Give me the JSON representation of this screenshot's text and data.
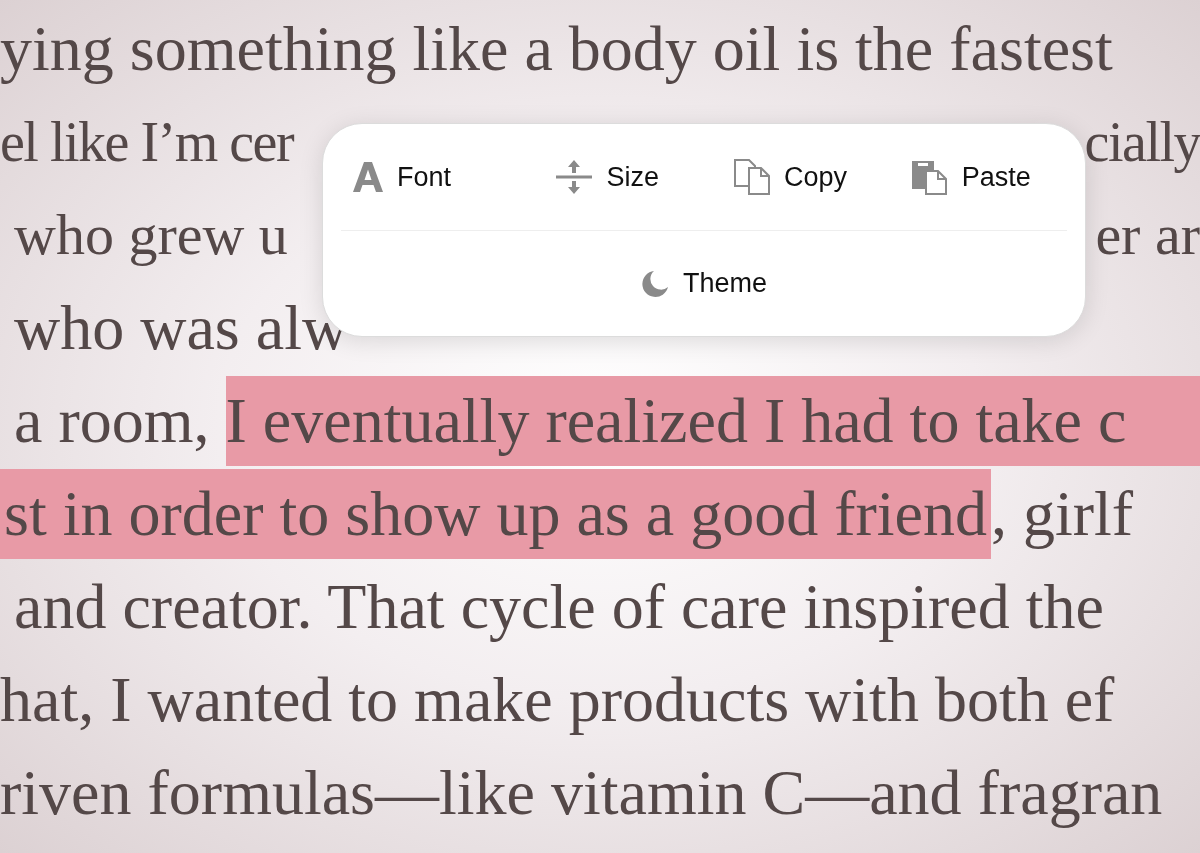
{
  "text_lines": [
    {
      "kind": "flow",
      "segments": [
        {
          "text": "ying something like a body oil is the fastest",
          "highlighted": false
        }
      ]
    },
    {
      "kind": "split",
      "segments": [
        {
          "text": "el like I’m cer",
          "highlighted": false
        },
        {
          "text": "cially",
          "highlighted": false
        }
      ]
    },
    {
      "kind": "split_indented",
      "segments": [
        {
          "text": "who grew u",
          "highlighted": false
        },
        {
          "text": "er ar",
          "highlighted": false
        }
      ]
    },
    {
      "kind": "indented",
      "segments": [
        {
          "text": "who was alw",
          "highlighted": false
        }
      ]
    },
    {
      "kind": "indented",
      "segments": [
        {
          "text": "a room, ",
          "highlighted": false
        },
        {
          "text": "I eventually realized I had to take c",
          "highlighted": true
        }
      ]
    },
    {
      "kind": "flow",
      "segments": [
        {
          "text": "st in order to show up as a good friend",
          "highlighted": true
        },
        {
          "text": ", girlf",
          "highlighted": false
        }
      ]
    },
    {
      "kind": "indented",
      "segments": [
        {
          "text": "and creator. That cycle of care inspired the",
          "highlighted": false
        }
      ]
    },
    {
      "kind": "flow",
      "segments": [
        {
          "text": "hat, I wanted to make products with both ef",
          "highlighted": false
        }
      ]
    },
    {
      "kind": "flow",
      "segments": [
        {
          "text": "riven formulas—like vitamin C—and fragran",
          "highlighted": false
        }
      ]
    }
  ],
  "menu": {
    "top_row": [
      {
        "kind": "font",
        "label": "Font"
      },
      {
        "kind": "size",
        "label": "Size"
      },
      {
        "kind": "copy",
        "label": "Copy"
      },
      {
        "kind": "paste",
        "label": "Paste"
      }
    ],
    "bottom_row": [
      {
        "kind": "theme",
        "label": "Theme"
      }
    ]
  }
}
